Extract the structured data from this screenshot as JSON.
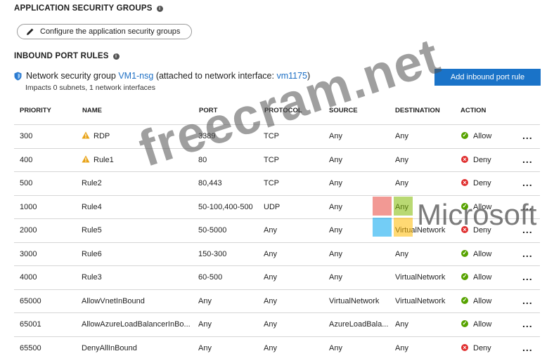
{
  "asg": {
    "title": "APPLICATION SECURITY GROUPS",
    "configure_label": "Configure the application security groups"
  },
  "inbound": {
    "title": "INBOUND PORT RULES",
    "nsg_prefix": "Network security group ",
    "nsg_name": "VM1-nsg",
    "nsg_middle": " (attached to network interface: ",
    "nic_name": "vm1175",
    "nsg_suffix": ")",
    "impacts": "Impacts 0 subnets, 1 network interfaces",
    "add_button": "Add inbound port rule"
  },
  "columns": [
    "PRIORITY",
    "NAME",
    "PORT",
    "PROTOCOL",
    "SOURCE",
    "DESTINATION",
    "ACTION"
  ],
  "rules": [
    {
      "priority": "300",
      "name": "RDP",
      "warning": true,
      "port": "3389",
      "protocol": "TCP",
      "source": "Any",
      "destination": "Any",
      "action": "Allow"
    },
    {
      "priority": "400",
      "name": "Rule1",
      "warning": true,
      "port": "80",
      "protocol": "TCP",
      "source": "Any",
      "destination": "Any",
      "action": "Deny"
    },
    {
      "priority": "500",
      "name": "Rule2",
      "warning": false,
      "port": "80,443",
      "protocol": "TCP",
      "source": "Any",
      "destination": "Any",
      "action": "Deny"
    },
    {
      "priority": "1000",
      "name": "Rule4",
      "warning": false,
      "port": "50-100,400-500",
      "protocol": "UDP",
      "source": "Any",
      "destination": "Any",
      "action": "Allow"
    },
    {
      "priority": "2000",
      "name": "Rule5",
      "warning": false,
      "port": "50-5000",
      "protocol": "Any",
      "source": "Any",
      "destination": "VirtualNetwork",
      "action": "Deny"
    },
    {
      "priority": "3000",
      "name": "Rule6",
      "warning": false,
      "port": "150-300",
      "protocol": "Any",
      "source": "Any",
      "destination": "Any",
      "action": "Allow"
    },
    {
      "priority": "4000",
      "name": "Rule3",
      "warning": false,
      "port": "60-500",
      "protocol": "Any",
      "source": "Any",
      "destination": "VirtualNetwork",
      "action": "Allow"
    },
    {
      "priority": "65000",
      "name": "AllowVnetInBound",
      "warning": false,
      "port": "Any",
      "protocol": "Any",
      "source": "VirtualNetwork",
      "destination": "VirtualNetwork",
      "action": "Allow"
    },
    {
      "priority": "65001",
      "name": "AllowAzureLoadBalancerInBo...",
      "warning": false,
      "port": "Any",
      "protocol": "Any",
      "source": "AzureLoadBala...",
      "destination": "Any",
      "action": "Allow"
    },
    {
      "priority": "65500",
      "name": "DenyAllInBound",
      "warning": false,
      "port": "Any",
      "protocol": "Any",
      "source": "Any",
      "destination": "Any",
      "action": "Deny"
    }
  ],
  "more_label": "...",
  "watermark": "freecram.net",
  "brand_text": "Microsoft",
  "colors": {
    "accent": "#1a73c8",
    "link": "#1d6fc4",
    "allow": "#57a300",
    "deny": "#e03030",
    "warning": "#e8a317"
  }
}
